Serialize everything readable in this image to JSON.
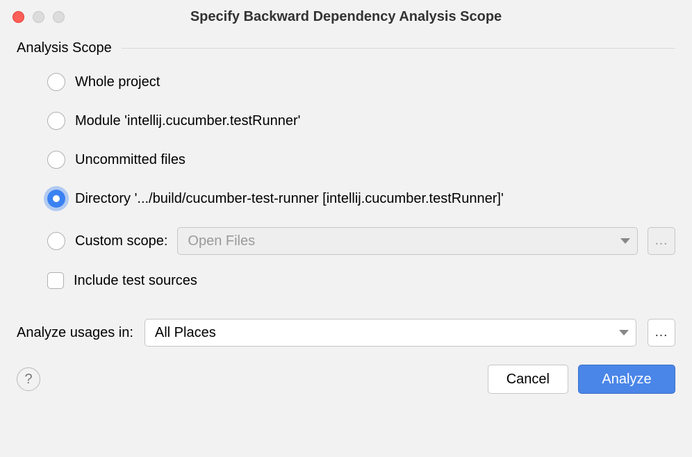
{
  "window": {
    "title": "Specify Backward Dependency Analysis Scope"
  },
  "section": {
    "title": "Analysis Scope"
  },
  "options": {
    "whole_project": "Whole project",
    "module": "Module 'intellij.cucumber.testRunner'",
    "uncommitted": "Uncommitted files",
    "directory": "Directory '.../build/cucumber-test-runner [intellij.cucumber.testRunner]'",
    "custom_scope": "Custom scope:",
    "custom_scope_value": "Open Files",
    "include_test": "Include test sources"
  },
  "usages": {
    "label": "Analyze usages in:",
    "value": "All Places"
  },
  "buttons": {
    "ellipsis": "...",
    "help": "?",
    "cancel": "Cancel",
    "analyze": "Analyze"
  }
}
